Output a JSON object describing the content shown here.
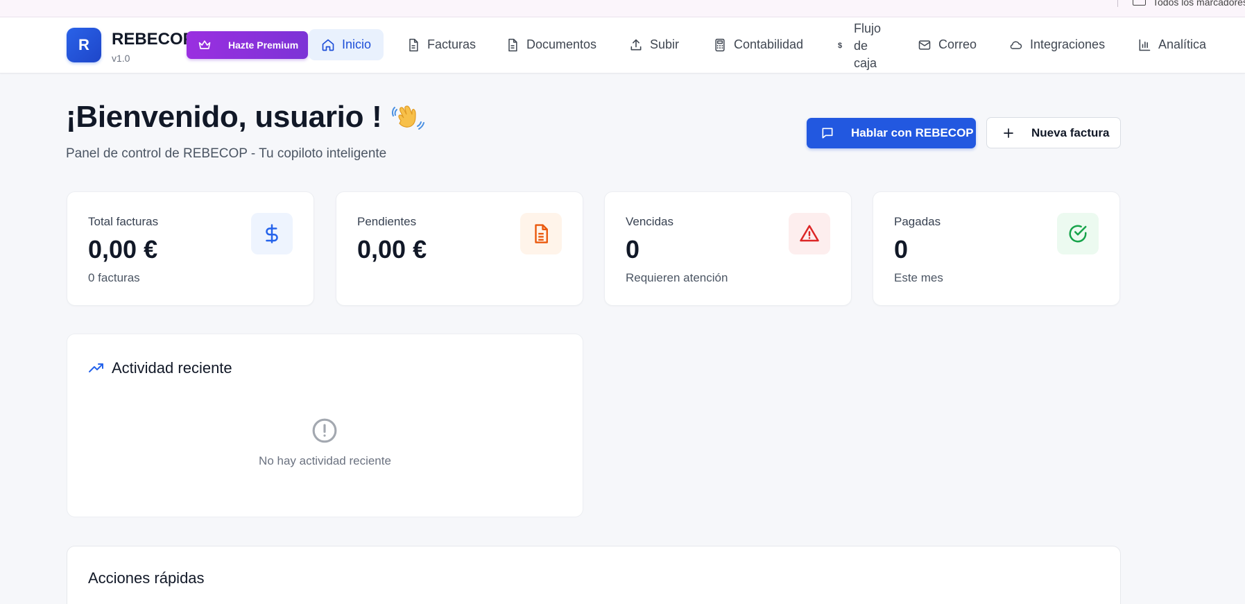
{
  "browser": {
    "bookmarks_label": "Todos los marcadores"
  },
  "brand": {
    "logo_letter": "R",
    "name": "REBECOP",
    "version": "v1.0",
    "accent_color": "#2258e0",
    "premium_color": "#8b31dc"
  },
  "premium": {
    "label": "Hazte Premium"
  },
  "nav": {
    "items": [
      {
        "label": "Inicio",
        "icon": "home-icon",
        "active": true
      },
      {
        "label": "Facturas",
        "icon": "document-icon"
      },
      {
        "label": "Documentos",
        "icon": "document-icon"
      },
      {
        "label": "Subir",
        "icon": "upload-icon"
      },
      {
        "label": "Contabilidad",
        "icon": "calculator-icon"
      },
      {
        "label": "Flujo de caja",
        "icon": "dollar-icon"
      },
      {
        "label": "Correo",
        "icon": "mail-icon"
      },
      {
        "label": "Integraciones",
        "icon": "cloud-icon"
      },
      {
        "label": "Analítica",
        "icon": "bar-chart-icon"
      }
    ]
  },
  "header": {
    "title": "¡Bienvenido, usuario !",
    "subtitle": "Panel de control de REBECOP - Tu copiloto inteligente",
    "chat_button": "Hablar con REBECOP",
    "new_invoice_button": "Nueva factura"
  },
  "stats": [
    {
      "label": "Total facturas",
      "value": "0,00 €",
      "sub": "0 facturas",
      "icon": "dollar-icon",
      "color": "#2563eb",
      "bg": "#eef4fe"
    },
    {
      "label": "Pendientes",
      "value": "0,00 €",
      "sub": "",
      "icon": "document-icon",
      "color": "#ea580c",
      "bg": "#fff4ea"
    },
    {
      "label": "Vencidas",
      "value": "0",
      "sub": "Requieren atención",
      "icon": "alert-triangle-icon",
      "color": "#dc2626",
      "bg": "#fdeeee"
    },
    {
      "label": "Pagadas",
      "value": "0",
      "sub": "Este mes",
      "icon": "check-circle-icon",
      "color": "#16a34a",
      "bg": "#ecfaf0"
    }
  ],
  "activity": {
    "title": "Actividad reciente",
    "empty_text": "No hay actividad reciente"
  },
  "quick_actions": {
    "title": "Acciones rápidas"
  }
}
